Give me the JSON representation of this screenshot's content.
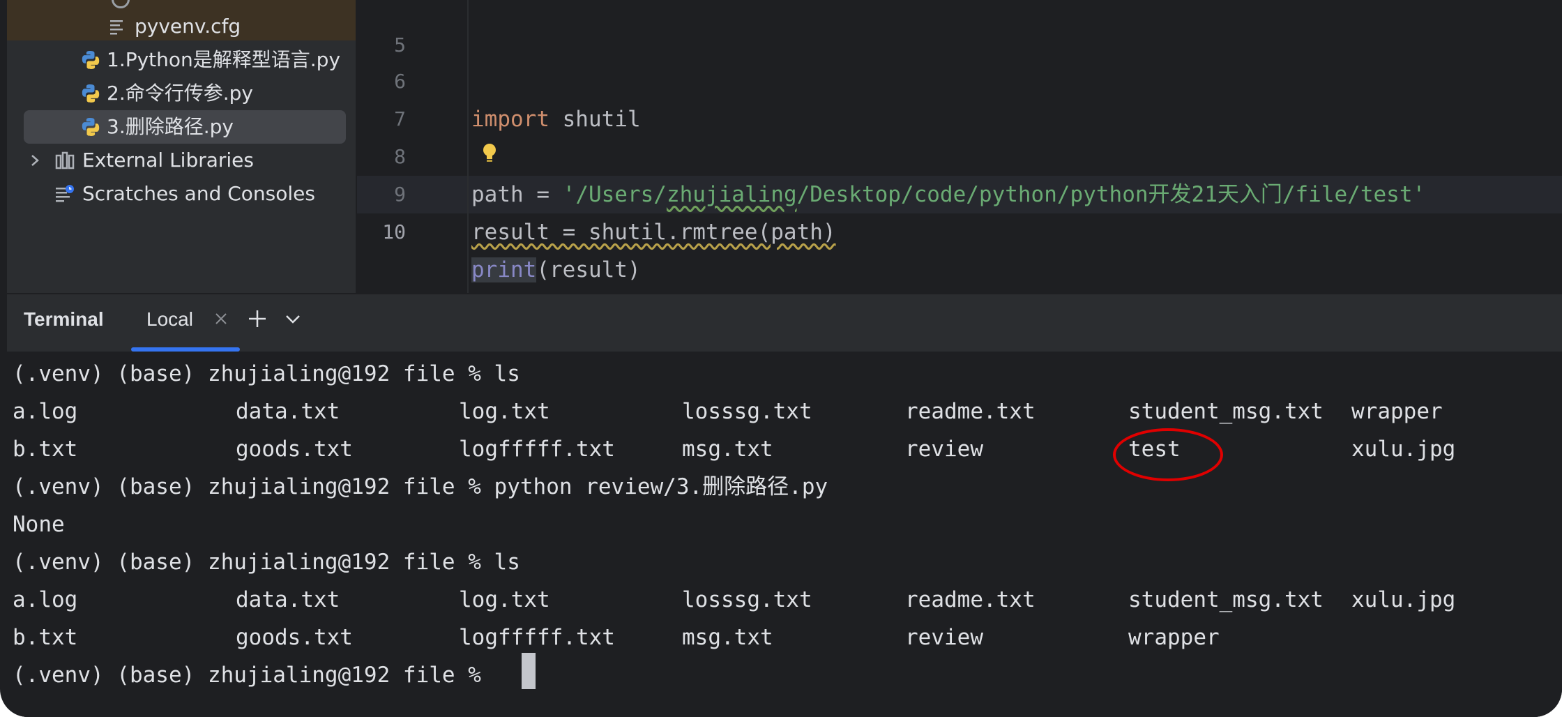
{
  "sidebar": {
    "items": [
      {
        "label": "pyvenv.cfg",
        "icon": "text-file-icon"
      },
      {
        "label": "1.Python是解释型语言.py",
        "icon": "python-file-icon"
      },
      {
        "label": "2.命令行传参.py",
        "icon": "python-file-icon"
      },
      {
        "label": "3.删除路径.py",
        "icon": "python-file-icon",
        "selected": true
      },
      {
        "label": "External Libraries",
        "icon": "library-icon"
      },
      {
        "label": "Scratches and Consoles",
        "icon": "scratches-icon"
      }
    ]
  },
  "editor": {
    "lines": [
      {
        "number": "5",
        "code": ""
      },
      {
        "number": "6",
        "kw": "import",
        "rest": " shutil"
      },
      {
        "number": "7",
        "code": ""
      },
      {
        "number": "8",
        "prefix": "path = ",
        "str_open": "'/Users/",
        "str_user": "zhujialing",
        "str_rest": "/Desktop/code/python/python开发21天入门/file/test'"
      },
      {
        "number": "9",
        "code": "result = shutil.rmtree(path)"
      },
      {
        "number": "10",
        "builtin": "print",
        "rest": "(result)"
      }
    ],
    "current_line": "10"
  },
  "terminal": {
    "title": "Terminal",
    "tab_label": "Local",
    "prompt": "(.venv) (base) zhujialing@192 file %",
    "lines": [
      "(.venv) (base) zhujialing@192 file % ls",
      "(.venv) (base) zhujialing@192 file % python review/3.删除路径.py",
      "None",
      "(.venv) (base) zhujialing@192 file % ls",
      "(.venv) (base) zhujialing@192 file % "
    ],
    "listing1": {
      "row1": [
        "a.log",
        "data.txt",
        "log.txt",
        "losssg.txt",
        "readme.txt",
        "student_msg.txt",
        "wrapper"
      ],
      "row2": [
        "b.txt",
        "goods.txt",
        "logfffff.txt",
        "msg.txt",
        "review",
        "test",
        "xulu.jpg"
      ]
    },
    "listing2": {
      "row1": [
        "a.log",
        "data.txt",
        "log.txt",
        "losssg.txt",
        "readme.txt",
        "student_msg.txt",
        "xulu.jpg"
      ],
      "row2": [
        "b.txt",
        "goods.txt",
        "logfffff.txt",
        "msg.txt",
        "review",
        "wrapper"
      ]
    }
  },
  "colors": {
    "keyword": "#cf8e6d",
    "string": "#6aab73",
    "builtin": "#8888c6",
    "accent": "#3574f0",
    "annotation": "#e00000"
  }
}
